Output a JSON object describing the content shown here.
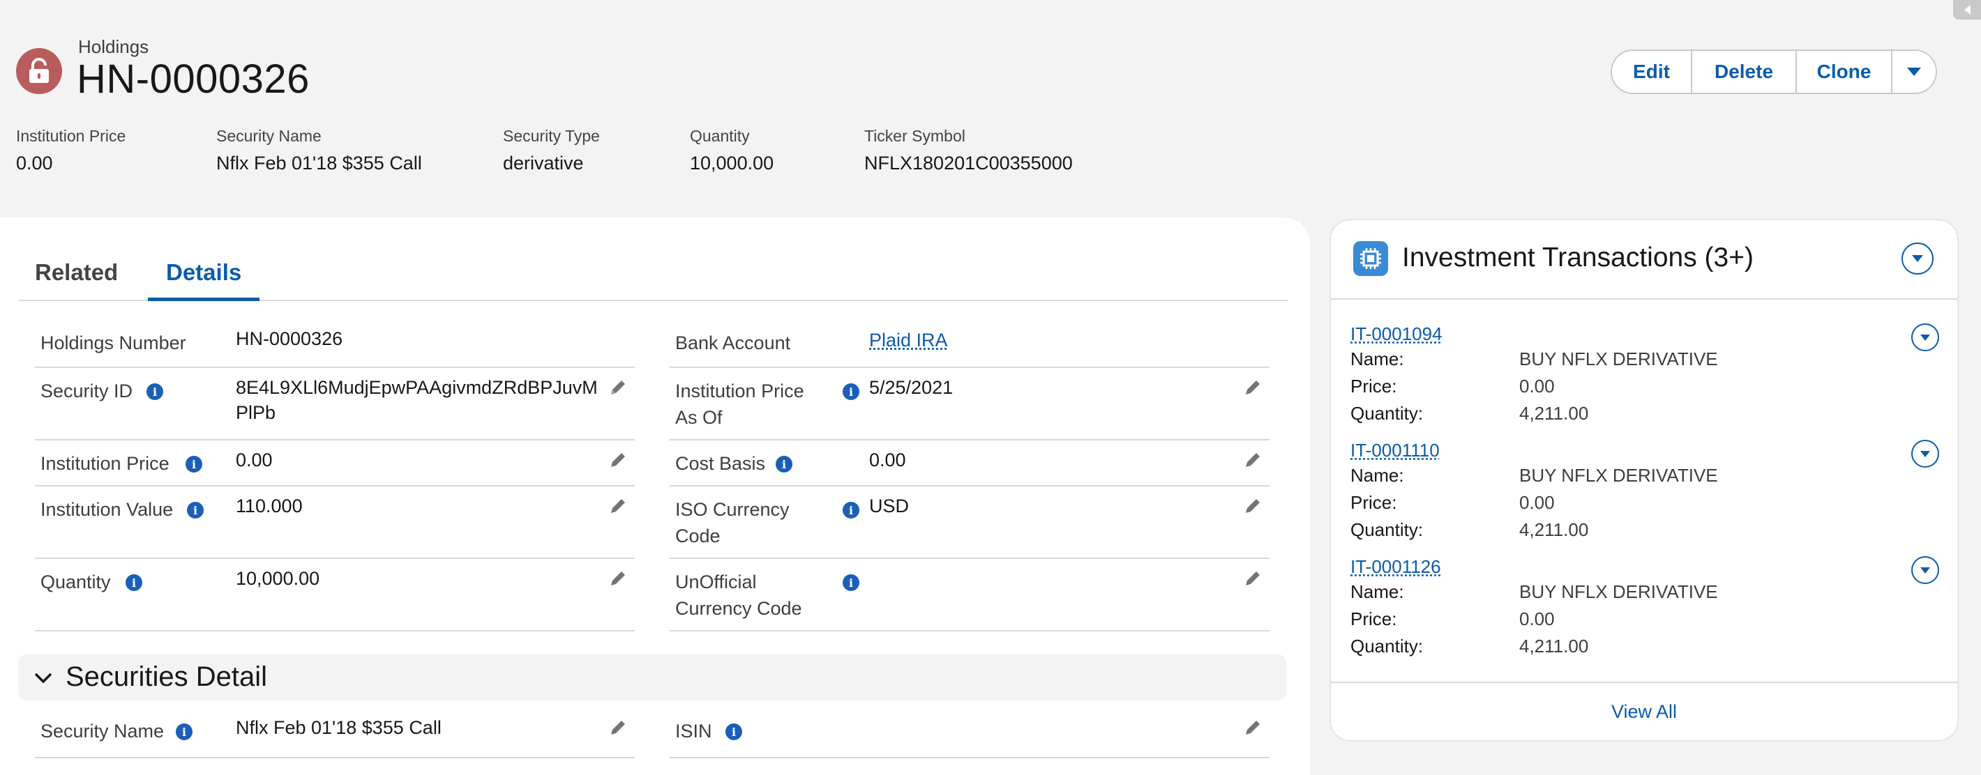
{
  "header": {
    "object_label": "Holdings",
    "record_name": "HN-0000326",
    "buttons": {
      "edit": "Edit",
      "delete": "Delete",
      "clone": "Clone"
    },
    "highlights": [
      {
        "label": "Institution Price",
        "value": "0.00"
      },
      {
        "label": "Security Name",
        "value": "Nflx Feb 01'18 $355 Call"
      },
      {
        "label": "Security Type",
        "value": "derivative"
      },
      {
        "label": "Quantity",
        "value": "10,000.00"
      },
      {
        "label": "Ticker Symbol",
        "value": "NFLX180201C00355000"
      }
    ]
  },
  "tabs": {
    "related": "Related",
    "details": "Details",
    "active": "Details"
  },
  "details": {
    "left": [
      {
        "label": "Holdings Number",
        "value": "HN-0000326"
      },
      {
        "label": "Security ID",
        "value_line1": "8E4L9XLl6MudjEpwPAAgivmdZRdBPJuvM",
        "value_line2": "PlPb"
      },
      {
        "label": "Institution Price",
        "value": "0.00"
      },
      {
        "label": "Institution Value",
        "value": "110.000"
      },
      {
        "label": "Quantity",
        "value": "10,000.00"
      }
    ],
    "right": [
      {
        "label": "Bank Account",
        "value": "Plaid IRA"
      },
      {
        "label_line1": "Institution Price",
        "label_line2": "As Of",
        "value": "5/25/2021"
      },
      {
        "label": "Cost Basis",
        "value": "0.00"
      },
      {
        "label_line1": "ISO Currency",
        "label_line2": "Code",
        "value": "USD"
      },
      {
        "label_line1": "UnOfficial",
        "label_line2": "Currency Code",
        "value": ""
      }
    ]
  },
  "securities_section": {
    "title": "Securities Detail",
    "fields": [
      {
        "label": "Security Name",
        "value": "Nflx Feb 01'18 $355 Call"
      },
      {
        "label": "ISIN",
        "value": ""
      }
    ]
  },
  "investment_transactions": {
    "title": "Investment Transactions (3+)",
    "name_label": "Name:",
    "price_label": "Price:",
    "quantity_label": "Quantity:",
    "items": [
      {
        "id": "IT-0001094",
        "name": "BUY NFLX DERIVATIVE",
        "price": "0.00",
        "quantity": "4,211.00"
      },
      {
        "id": "IT-0001110",
        "name": "BUY NFLX DERIVATIVE",
        "price": "0.00",
        "quantity": "4,211.00"
      },
      {
        "id": "IT-0001126",
        "name": "BUY NFLX DERIVATIVE",
        "price": "0.00",
        "quantity": "4,211.00"
      }
    ],
    "view_all": "View All"
  },
  "icons": {
    "record": "lock-icon",
    "info": "info-icon",
    "edit": "pencil-icon",
    "dropdown": "chevron-down-icon",
    "section": "chevron-down-icon",
    "related_list": "transactions-icon"
  },
  "colors": {
    "accent": "#0b5cab",
    "record_icon_bg": "#b85d5b",
    "info_icon": "#1b5fb8",
    "page_bg": "#f3f3f3"
  }
}
